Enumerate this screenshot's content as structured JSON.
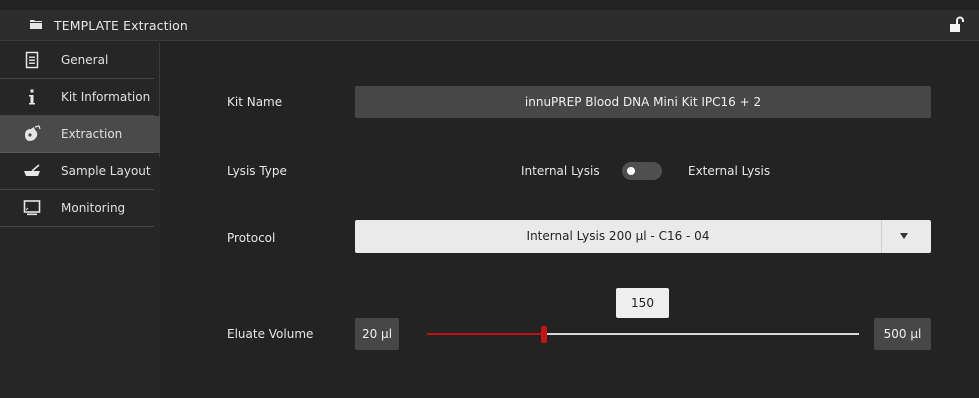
{
  "window": {
    "title": "TEMPLATE Extraction",
    "folder_icon": "folder-icon",
    "lock_icon": "unlock-icon"
  },
  "sidebar": {
    "items": [
      {
        "label": "General",
        "icon": "document-icon",
        "active": false
      },
      {
        "label": "Kit Information",
        "icon": "info-icon",
        "active": false
      },
      {
        "label": "Extraction",
        "icon": "extraction-icon",
        "active": true
      },
      {
        "label": "Sample Layout",
        "icon": "sample-tray-icon",
        "active": false
      },
      {
        "label": "Monitoring",
        "icon": "monitor-icon",
        "active": false
      }
    ]
  },
  "form": {
    "kit_name": {
      "label": "Kit Name",
      "value": "innuPREP Blood DNA Mini Kit IPC16 + 2"
    },
    "lysis_type": {
      "label": "Lysis Type",
      "left_option": "Internal Lysis",
      "right_option": "External Lysis",
      "selected": "Internal Lysis"
    },
    "protocol": {
      "label": "Protocol",
      "value": "Internal Lysis 200 µl - C16 - 04"
    },
    "eluate_volume": {
      "label": "Eluate Volume",
      "min_label": "20 µl",
      "max_label": "500 µl",
      "min": 20,
      "max": 500,
      "value": 150,
      "value_label": "150"
    }
  },
  "colors": {
    "accent": "#c21515",
    "panel": "#474747",
    "background": "#232323",
    "sidebar_active": "#4a4a4a"
  }
}
